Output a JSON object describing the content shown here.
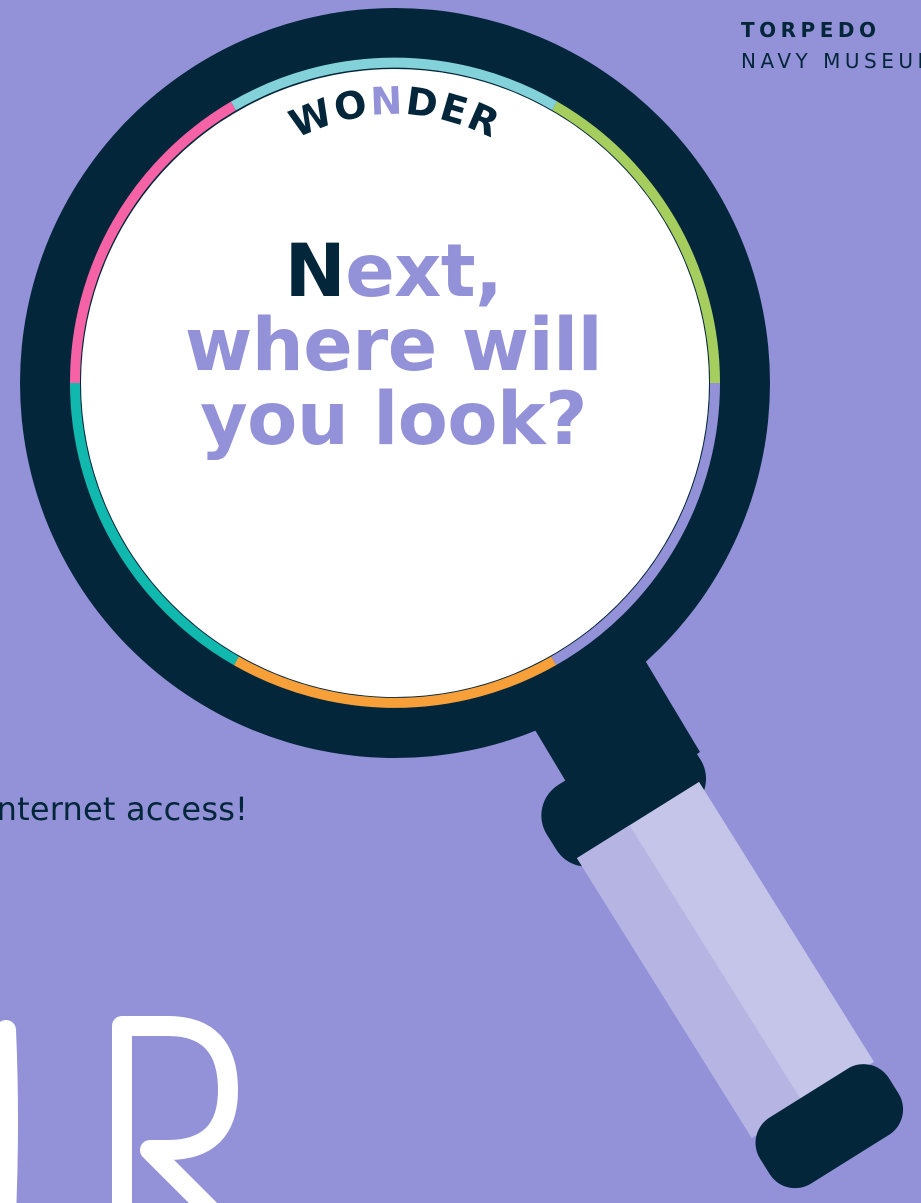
{
  "brand": {
    "line1": "TORPEDO",
    "line2": "NAVY MUSEUM"
  },
  "body_text": "Internet access!",
  "lens": {
    "arc_word_parts": [
      "WO",
      "N",
      "DER"
    ],
    "headline": {
      "first_letter": "N",
      "line1_rest": "ext,",
      "line2": "where will",
      "line3": "you look?"
    }
  },
  "big_outline_letters": "ER",
  "colors": {
    "background": "#9392d8",
    "navy": "#04263a",
    "white": "#ffffff",
    "cyan": "#83d2da",
    "green": "#a5ce5e",
    "purple": "#9392d8",
    "orange": "#f7a03a",
    "teal": "#11b8ae",
    "pink": "#f563a6",
    "handle_light": "#c5c5ea",
    "handle_mid": "#b5b4e3"
  }
}
